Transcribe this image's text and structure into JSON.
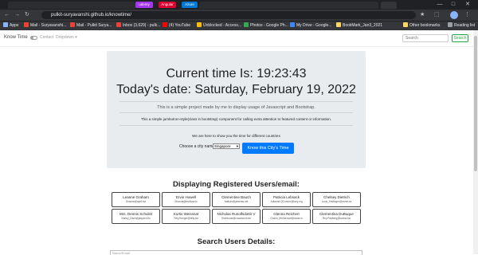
{
  "browser": {
    "tabs": [
      "udemy",
      "Angular",
      "Azure",
      "Know Time"
    ],
    "url": "pulkit-suryavanshi.github.io/knowtime/",
    "bookmarks": [
      "Apps",
      "Mail - Suryavanshi...",
      "Mail - Pulkit Surya...",
      "Inbox (3,629) - pulk...",
      "(4) YouTube",
      "Unblocked - Access...",
      "Photos - Google Ph...",
      "My Drive - Google...",
      "BookMark_Jan3_2021",
      "Other bookmarks",
      "Reading list"
    ],
    "colors": {
      "udemy": "#a435f0",
      "angular": "#dd0031",
      "azure": "#0078d4"
    }
  },
  "navbar": {
    "brand": "Know Time",
    "contact": "Contact",
    "dropdown": "Dropdown",
    "search_placeholder": "Search",
    "search_button": "Search"
  },
  "jumbotron": {
    "time_line": "Current time Is: 19:23:43",
    "date_line": "Today's date: Saturday, February 19, 2022",
    "lead": "This is a simple project made by me to display usage of Javascript and Bootstrap.",
    "description": "This a simple jumbotron-style(class in bootstrap) component for calling extra attention to featured content or information.",
    "here_text": "We are here to show you the time for different countries",
    "choose_label": "Choose a city name:",
    "city_selected": "Singapore",
    "cta": "Know this City's Time"
  },
  "users": {
    "heading": "Displaying Registered Users/email:",
    "list": [
      {
        "name": "Leanne Graham",
        "email": "Sincere@april.biz"
      },
      {
        "name": "Ervin Howell",
        "email": "Shanna@melissa.tv"
      },
      {
        "name": "Clementine Bauch",
        "email": "Nathan@yesenia.net"
      },
      {
        "name": "Patricia Lebsack",
        "email": "Julianne.OConner@kory.org"
      },
      {
        "name": "Chelsey Dietrich",
        "email": "Lucio_Hettinger@annie.ca"
      },
      {
        "name": "Mrs. Dennis Schulist",
        "email": "Karley_Dach@jasper.info"
      },
      {
        "name": "Kurtis Weissnat",
        "email": "Telly.Hoeger@billy.biz"
      },
      {
        "name": "Nicholas Runolfsdottir V",
        "email": "Sherwood@rosamond.me"
      },
      {
        "name": "Glenna Reichert",
        "email": "Chaim_McDermott@dana.io"
      },
      {
        "name": "Clementina DuBuque",
        "email": "Rey.Padberg@karina.biz"
      }
    ]
  },
  "search_users": {
    "heading": "Search Users Details:",
    "placeholder": "Name/Email"
  }
}
